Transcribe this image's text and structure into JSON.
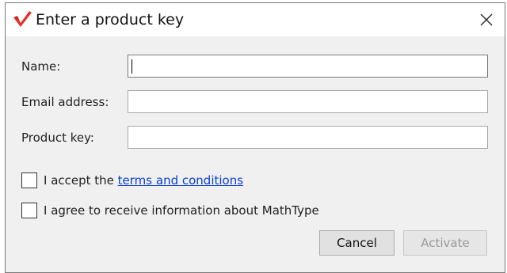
{
  "dialog": {
    "title": "Enter a product key",
    "fields": {
      "name_label": "Name:",
      "name_value": "",
      "email_label": "Email address:",
      "email_value": "",
      "key_label": "Product key:",
      "key_value": ""
    },
    "terms": {
      "prefix": "I accept the ",
      "link_text": "terms and conditions",
      "checked": false
    },
    "info": {
      "label": "I agree to receive information about MathType",
      "checked": false
    },
    "buttons": {
      "cancel": "Cancel",
      "activate": "Activate",
      "activate_enabled": false
    }
  },
  "icons": {
    "app": "mathtype-logo-icon",
    "close": "close-icon"
  },
  "colors": {
    "logo": "#e0322b",
    "link": "#0b3fd6",
    "disabled_text": "#9b9b9b"
  }
}
